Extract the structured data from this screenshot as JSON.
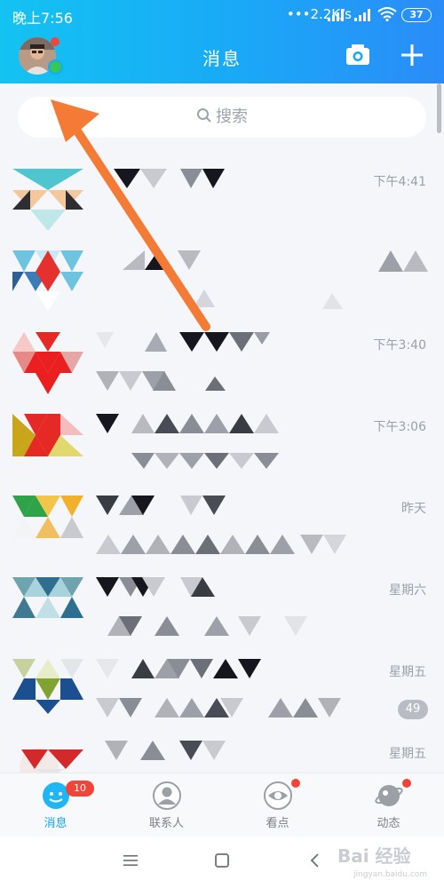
{
  "status": {
    "time": "晚上7:56",
    "network": "2.2K/s",
    "battery": "37"
  },
  "header": {
    "title": "消息",
    "camera_icon": "camera-icon",
    "add_icon": "plus-icon"
  },
  "search": {
    "placeholder": "搜索"
  },
  "conversations": [
    {
      "time": "下午4:41",
      "badge": ""
    },
    {
      "time": "",
      "badge": ""
    },
    {
      "time": "下午3:40",
      "badge": ""
    },
    {
      "time": "下午3:06",
      "badge": ""
    },
    {
      "time": "昨天",
      "badge": ""
    },
    {
      "time": "星期六",
      "badge": ""
    },
    {
      "time": "星期五",
      "badge": "49"
    },
    {
      "time": "星期五",
      "badge": ""
    }
  ],
  "tabs": [
    {
      "label": "消息",
      "icon": "message-icon",
      "count": "10",
      "active": true
    },
    {
      "label": "联系人",
      "icon": "contacts-icon",
      "active": false
    },
    {
      "label": "看点",
      "icon": "eye-icon",
      "dot": true,
      "active": false
    },
    {
      "label": "动态",
      "icon": "planet-icon",
      "dot": true,
      "active": false
    }
  ],
  "watermark": {
    "brand": "Bai 经验",
    "url": "jingyan.baidu.com"
  },
  "colors": {
    "header": "#17a9f5",
    "accent": "#14a7f2",
    "badge_red": "#f2453a",
    "arrow": "#f47b36"
  }
}
